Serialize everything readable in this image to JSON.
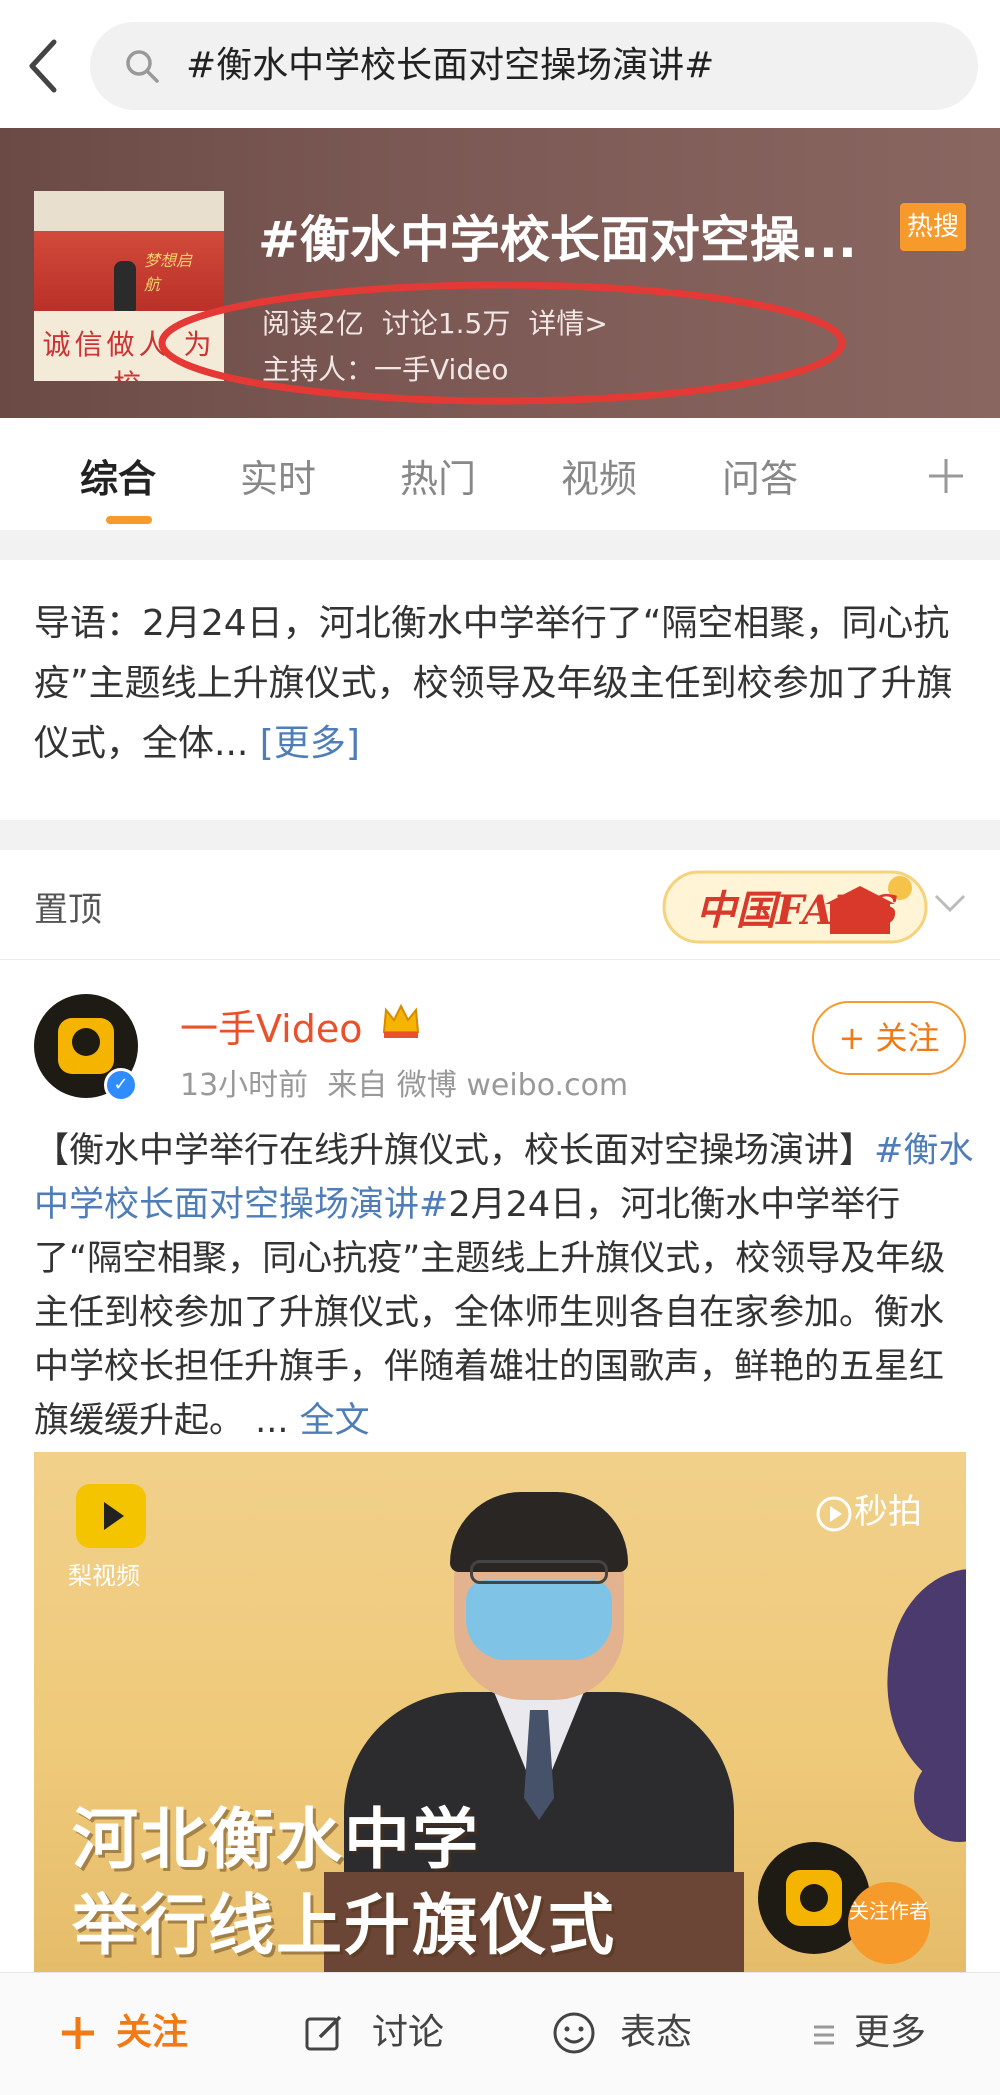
{
  "search": {
    "query": "#衡水中学校长面对空操场演讲#"
  },
  "topic": {
    "title": "#衡水中学校长面对空操...",
    "badge": "热搜",
    "reads": "阅读2亿",
    "discussions": "讨论1.5万",
    "details": "详情>",
    "host": "主持人：一手Video",
    "thumb_text": "诚信做人 为校",
    "thumb_gold": "梦想启航"
  },
  "tabs": [
    {
      "label": "综合",
      "active": true
    },
    {
      "label": "实时",
      "active": false
    },
    {
      "label": "热门",
      "active": false
    },
    {
      "label": "视频",
      "active": false
    },
    {
      "label": "问答",
      "active": false
    }
  ],
  "lead": {
    "text": "导语：2月24日，河北衡水中学举行了“隔空相聚，同心抗疫”主题线上升旗仪式，校领导及年级主任到校参加了升旗仪式，全体...",
    "more": "[更多]"
  },
  "pinned": {
    "label": "置顶",
    "fans_badge": "中国FANS"
  },
  "post": {
    "username": "一手Video",
    "time": "13小时前",
    "source": "来自 微博 weibo.com",
    "follow": "+ 关注",
    "text_a": "【衡水中学举行在线升旗仪式，校长面对空操场演讲】",
    "hashtag": "#衡水中学校长面对空操场演讲#",
    "text_b": "2月24日，河北衡水中学举行了“隔空相聚，同心抗疫”主题线上升旗仪式，校领导及年级主任到校参加了升旗仪式，全体师生则各自在家参加。衡水中学校长担任升旗手，伴随着雄壮的国歌声，鲜艳的五星红旗缓缓升起。 ... ",
    "full_text": "全文"
  },
  "video": {
    "pear_label": "梨视频",
    "miaopai": "秒拍",
    "caption_line1": "河北衡水中学",
    "caption_line2": "举行线上升旗仪式",
    "follow_author": "关注作者"
  },
  "bottom": {
    "follow": "关注",
    "discuss": "讨论",
    "express": "表态",
    "more": "更多"
  },
  "colors": {
    "accent": "#f59a2b",
    "link": "#4f7db8",
    "username": "#e8512c",
    "annotation": "#e53935"
  }
}
